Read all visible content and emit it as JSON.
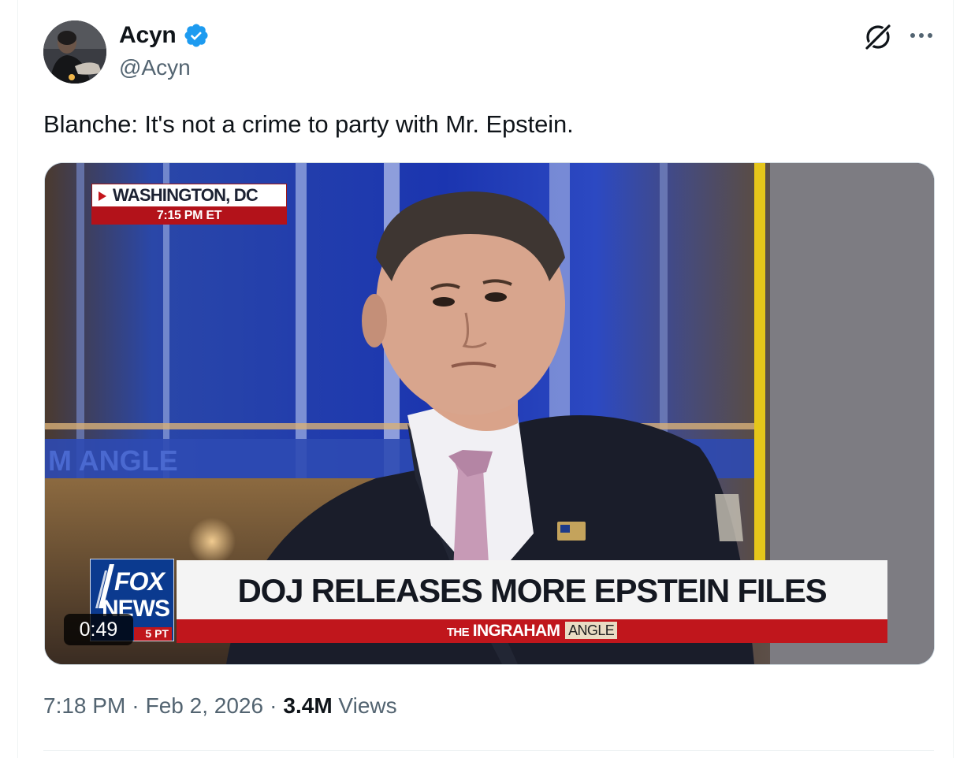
{
  "author": {
    "display_name": "Acyn",
    "handle": "@Acyn",
    "verified_icon": "verified-badge-icon",
    "accent_color": "#1d9bf0"
  },
  "header_actions": {
    "grok_icon": "grok-icon",
    "more_icon": "more-icon"
  },
  "tweet": {
    "text": "Blanche: It's not a crime to party with Mr. Epstein."
  },
  "video": {
    "duration": "0:49",
    "location": "WASHINGTON, DC",
    "broadcast_time": "7:15 PM ET",
    "headline": "DOJ RELEASES MORE EPSTEIN FILES",
    "show_the": "THE",
    "show_name": "INGRAHAM",
    "show_angle": "ANGLE",
    "network_fox": "FOX",
    "network_news": "NEWS",
    "network_pt": "5 PT",
    "background_text": "M ANGLE"
  },
  "meta": {
    "time": "7:18 PM",
    "date": "Feb 2, 2026",
    "views_count": "3.4M",
    "views_label": "Views",
    "separator": "·"
  }
}
